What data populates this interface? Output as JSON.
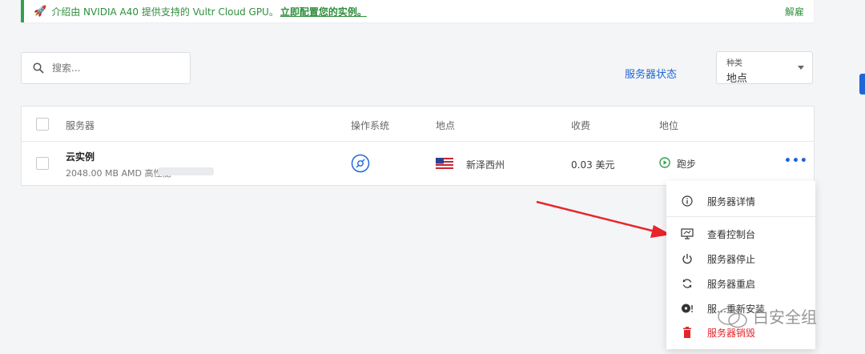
{
  "banner": {
    "text": "介绍由 NVIDIA A40 提供支持的 Vultr Cloud GPU。",
    "link": "立即配置您的实例。",
    "dismiss": "解雇"
  },
  "search": {
    "placeholder": "搜索..."
  },
  "server_status_link": "服务器状态",
  "type_select": {
    "label": "种类",
    "value": "地点"
  },
  "table": {
    "headers": [
      "服务器",
      "操作系统",
      "地点",
      "收费",
      "地位"
    ],
    "rows": [
      {
        "name": "云实例",
        "spec": "2048.00 MB AMD 高性能",
        "location": "新泽西州",
        "fee": "0.03 美元",
        "status": "跑步",
        "more": "•••"
      }
    ]
  },
  "menu": {
    "items": [
      {
        "label": "服务器详情",
        "icon": "info-icon"
      },
      {
        "label": "查看控制台",
        "icon": "console-icon"
      },
      {
        "label": "服务器停止",
        "icon": "power-icon"
      },
      {
        "label": "服务器重启",
        "icon": "restart-icon"
      },
      {
        "label": "服…重新安装",
        "icon": "reinstall-icon"
      },
      {
        "label": "服务器销毁",
        "icon": "trash-icon"
      }
    ]
  },
  "watermark": "白安全组",
  "colors": {
    "accent": "#1e66d6",
    "success": "#31a14e",
    "danger": "#e0262b",
    "arrow": "#e8252a"
  }
}
